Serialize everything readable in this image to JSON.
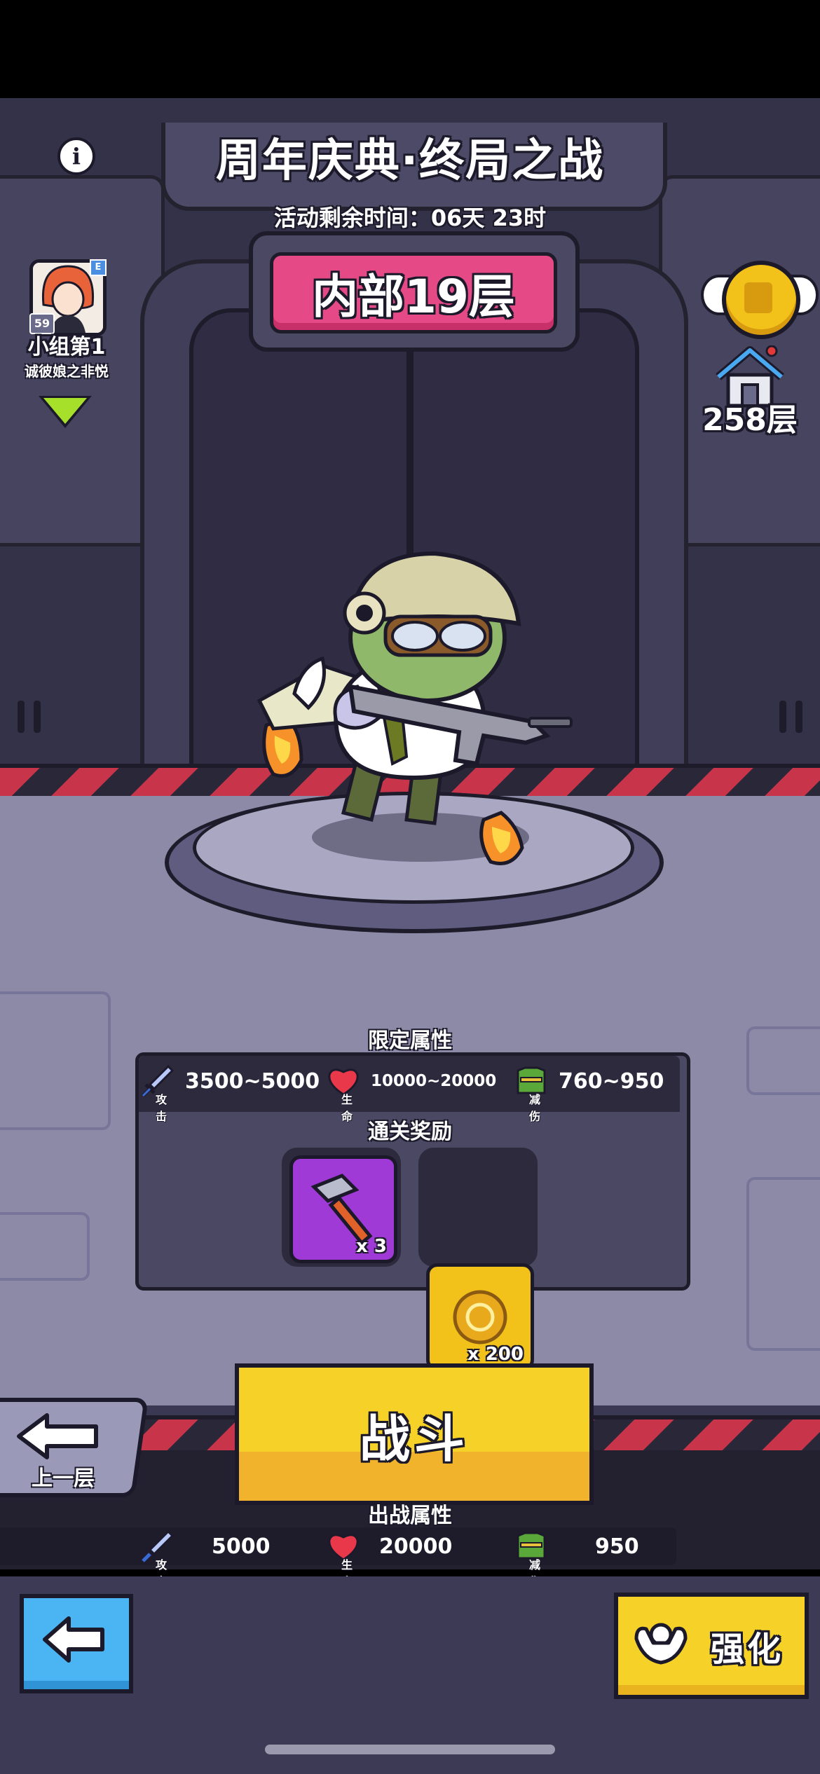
{
  "event": {
    "title": "周年庆典·终局之战",
    "timer_label": "活动剩余时间：",
    "timer_value": "06天 23时",
    "current_level": "内部19层"
  },
  "player": {
    "avatar_level": "59",
    "avatar_tag": "E",
    "group_label": "小组第1",
    "group_name": "诚彼娘之非悦"
  },
  "tower": {
    "floor_count": "258层"
  },
  "limit_attributes": {
    "title": "限定属性",
    "attack_tag": "攻击",
    "attack": "3500~5000",
    "life_tag": "生命",
    "life": "10000~20000",
    "defense_tag": "减伤",
    "defense": "760~950"
  },
  "rewards": {
    "title": "通关奖励",
    "items": [
      {
        "icon": "hammer-icon",
        "qty": "x 3",
        "color": "#a03ad6"
      },
      {
        "icon": "gold-coin-icon",
        "qty": "x 200",
        "color": "#f2c21a"
      }
    ]
  },
  "fight_button": {
    "label": "战斗"
  },
  "prev_floor_button": {
    "label": "上一层"
  },
  "battle_attributes": {
    "title": "出战属性",
    "attack_tag": "攻击",
    "attack": "5000",
    "life_tag": "生命",
    "life": "20000",
    "defense_tag": "减伤",
    "defense": "950"
  },
  "enhance_button": {
    "label": "强化"
  },
  "colors": {
    "accent_pink": "#e64a86",
    "accent_yellow": "#f6d228",
    "back_blue": "#4ab5f2",
    "hazard_red": "#c8344a"
  }
}
